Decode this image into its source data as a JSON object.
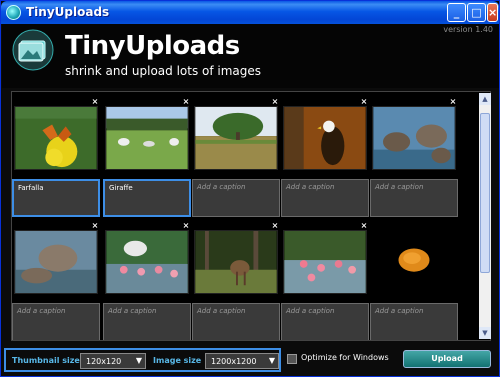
{
  "window": {
    "title": "TinyUploads"
  },
  "header": {
    "app_name": "TinyUploads",
    "tagline": "shrink and upload lots of images",
    "version": "version 1.40"
  },
  "grid": {
    "rows": [
      [
        {
          "caption": "Farfalla",
          "placeholder": "Add a caption",
          "image": "butterfly-on-flower"
        },
        {
          "caption": "Giraffe",
          "placeholder": "Add a caption",
          "image": "animals-on-grass"
        },
        {
          "caption": "",
          "placeholder": "Add a caption",
          "image": "tree-field"
        },
        {
          "caption": "",
          "placeholder": "Add a caption",
          "image": "eagle"
        },
        {
          "caption": "",
          "placeholder": "Add a caption",
          "image": "elephants-water"
        }
      ],
      [
        {
          "caption": "",
          "placeholder": "Add a caption",
          "image": "elephant"
        },
        {
          "caption": "",
          "placeholder": "Add a caption",
          "image": "flamingos"
        },
        {
          "caption": "",
          "placeholder": "Add a caption",
          "image": "deer-forest"
        },
        {
          "caption": "",
          "placeholder": "Add a caption",
          "image": "flamingos-pond"
        },
        {
          "caption": "",
          "placeholder": "Add a caption",
          "image": "orange-object-dark"
        }
      ]
    ],
    "delete_glyph": "×"
  },
  "settings": {
    "thumb_label": "Thumbnail size",
    "thumb_value": "120x120",
    "image_label": "Image size",
    "image_value": "1200x1200",
    "optimize_label": "Optimize for Windows",
    "upload_label": "Upload"
  },
  "icons": {
    "minimize": "minimize-icon",
    "maximize": "maximize-icon",
    "close": "close-icon",
    "dropdown": "chevron-down-icon",
    "delete": "close-icon"
  },
  "colors": {
    "accent": "#3d8ee6",
    "label": "#58b8e8",
    "upload": "#127272"
  }
}
